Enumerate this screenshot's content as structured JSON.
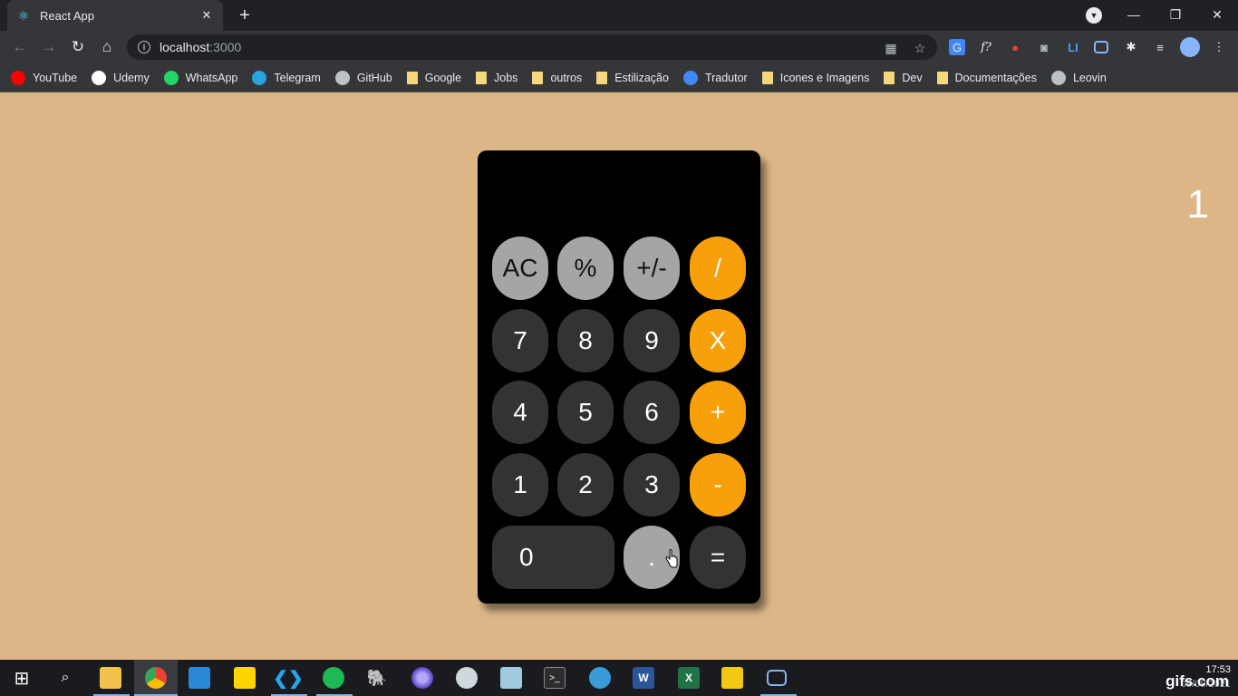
{
  "browser": {
    "tab_title": "React App",
    "url_host": "localhost",
    "url_port": ":3000",
    "bookmarks": [
      {
        "label": "YouTube",
        "icon": "youtube-icon",
        "color": "#ff0000"
      },
      {
        "label": "Udemy",
        "icon": "udemy-icon",
        "color": "#ffffff"
      },
      {
        "label": "WhatsApp",
        "icon": "whatsapp-icon",
        "color": "#25d366"
      },
      {
        "label": "Telegram",
        "icon": "telegram-icon",
        "color": "#2aa3df"
      },
      {
        "label": "GitHub",
        "icon": "github-icon",
        "color": "#bdc1c6"
      },
      {
        "label": "Google",
        "icon": "folder-icon",
        "color": "#f5d77e"
      },
      {
        "label": "Jobs",
        "icon": "folder-icon",
        "color": "#f5d77e"
      },
      {
        "label": "outros",
        "icon": "folder-icon",
        "color": "#f5d77e"
      },
      {
        "label": "Estilização",
        "icon": "folder-icon",
        "color": "#f5d77e"
      },
      {
        "label": "Tradutor",
        "icon": "google-translate-icon",
        "color": "#4285f4"
      },
      {
        "label": "Icones e Imagens",
        "icon": "folder-icon",
        "color": "#f5d77e"
      },
      {
        "label": "Dev",
        "icon": "folder-icon",
        "color": "#f5d77e"
      },
      {
        "label": "Documentações",
        "icon": "folder-icon",
        "color": "#f5d77e"
      },
      {
        "label": "Leovin",
        "icon": "leovin-icon",
        "color": "#bdc1c6"
      }
    ]
  },
  "calculator": {
    "display": "1",
    "keys": {
      "ac": "AC",
      "percent": "%",
      "sign": "+/-",
      "divide": "/",
      "seven": "7",
      "eight": "8",
      "nine": "9",
      "multiply": "X",
      "four": "4",
      "five": "5",
      "six": "6",
      "plus": "+",
      "one": "1",
      "two": "2",
      "three": "3",
      "minus": "-",
      "zero": "0",
      "dot": ".",
      "equals": "="
    },
    "colors": {
      "function": "#a5a5a5",
      "number": "#333333",
      "operator": "#f7a00b"
    }
  },
  "taskbar": {
    "time": "17:53",
    "date": "09/09/2021",
    "watermark": "gifs.com"
  }
}
